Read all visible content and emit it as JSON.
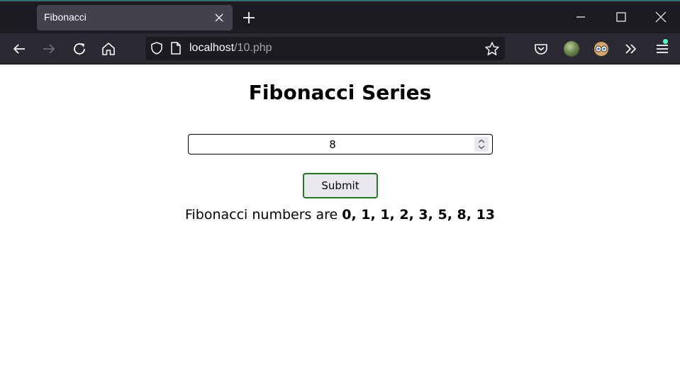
{
  "browser": {
    "tab": {
      "title": "Fibonacci"
    },
    "url": {
      "host": "localhost",
      "path": "/10.php"
    },
    "icons": {
      "tab_close": "close-icon",
      "new_tab": "plus-icon",
      "back": "back-arrow-icon",
      "forward": "forward-arrow-icon",
      "reload": "reload-icon",
      "home": "home-icon",
      "tracking": "shield-icon",
      "page": "page-icon",
      "bookmark": "star-icon",
      "pocket": "pocket-icon",
      "overflow": "chevron-double-right-icon",
      "menu": "hamburger-menu-icon"
    },
    "colors": {
      "titlebar": "#1c1b22",
      "toolbar": "#2b2a33",
      "tab_active": "#42414d",
      "notification_dot": "#54ffbd"
    }
  },
  "page": {
    "title": "Fibonacci Series",
    "input": {
      "value": "8"
    },
    "submit_label": "Submit",
    "result": {
      "prefix": "Fibonacci numbers are ",
      "numbers": "0, 1, 1, 2, 3, 5, 8, 13"
    },
    "colors": {
      "submit_border": "#1f7a1f"
    }
  }
}
